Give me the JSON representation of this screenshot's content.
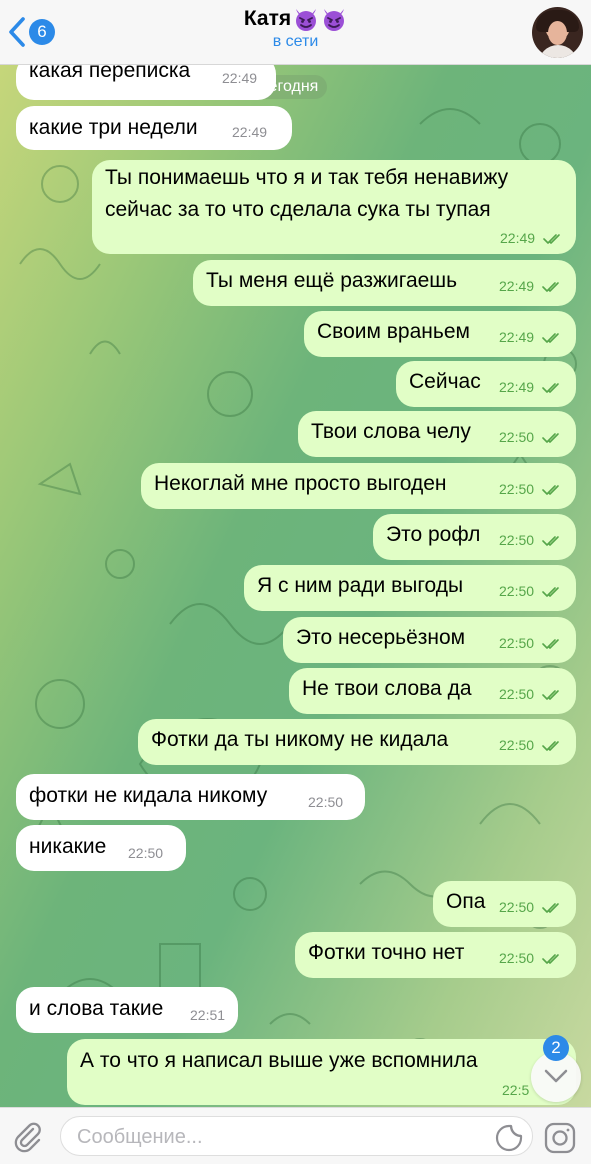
{
  "header": {
    "back_count": "6",
    "contact_name": "Катя",
    "status": "в сети"
  },
  "chat": {
    "date_label": "Сегодня",
    "messages": [
      {
        "dir": "in",
        "text": "какая переписка",
        "time": "22:49"
      },
      {
        "dir": "in",
        "text": "какие три недели",
        "time": "22:49"
      },
      {
        "dir": "out",
        "text": "Ты понимаешь что я и так тебя ненавижу",
        "text2": "сейчас за то что сделала сука ты тупая",
        "time": "22:49"
      },
      {
        "dir": "out",
        "text": "Ты меня ещё разжигаешь",
        "time": "22:49"
      },
      {
        "dir": "out",
        "text": "Своим враньем",
        "time": "22:49"
      },
      {
        "dir": "out",
        "text": "Сейчас",
        "time": "22:49"
      },
      {
        "dir": "out",
        "text": "Твои слова челу",
        "time": "22:50"
      },
      {
        "dir": "out",
        "text": "Некоглай мне просто выгоден",
        "time": "22:50"
      },
      {
        "dir": "out",
        "text": "Это рофл",
        "time": "22:50"
      },
      {
        "dir": "out",
        "text": "Я с ним ради выгоды",
        "time": "22:50"
      },
      {
        "dir": "out",
        "text": "Это несерьёзном",
        "time": "22:50"
      },
      {
        "dir": "out",
        "text": "Не твои слова да",
        "time": "22:50"
      },
      {
        "dir": "out",
        "text": "Фотки да ты никому не кидала",
        "time": "22:50"
      },
      {
        "dir": "in",
        "text": "фотки не кидала никому",
        "time": "22:50"
      },
      {
        "dir": "in",
        "text": "никакие",
        "time": "22:50"
      },
      {
        "dir": "out",
        "text": "Опа",
        "time": "22:50"
      },
      {
        "dir": "out",
        "text": "Фотки точно нет",
        "time": "22:50"
      },
      {
        "dir": "in",
        "text": "и слова такие",
        "time": "22:51"
      },
      {
        "dir": "out",
        "text": "А то что я написал выше уже вспомнила",
        "time": "22:5"
      }
    ],
    "unread_badge": "2"
  },
  "input": {
    "placeholder": "Сообщение..."
  },
  "colors": {
    "accent": "#2c8ae8",
    "incoming_bubble": "#ffffff",
    "outgoing_bubble": "#e1fec6",
    "outgoing_time": "#56a64a"
  },
  "icons": [
    "back-chevron-icon",
    "devil-emoji-icon",
    "paperclip-icon",
    "sticker-icon",
    "camera-icon",
    "chevron-down-icon",
    "double-check-icon"
  ]
}
